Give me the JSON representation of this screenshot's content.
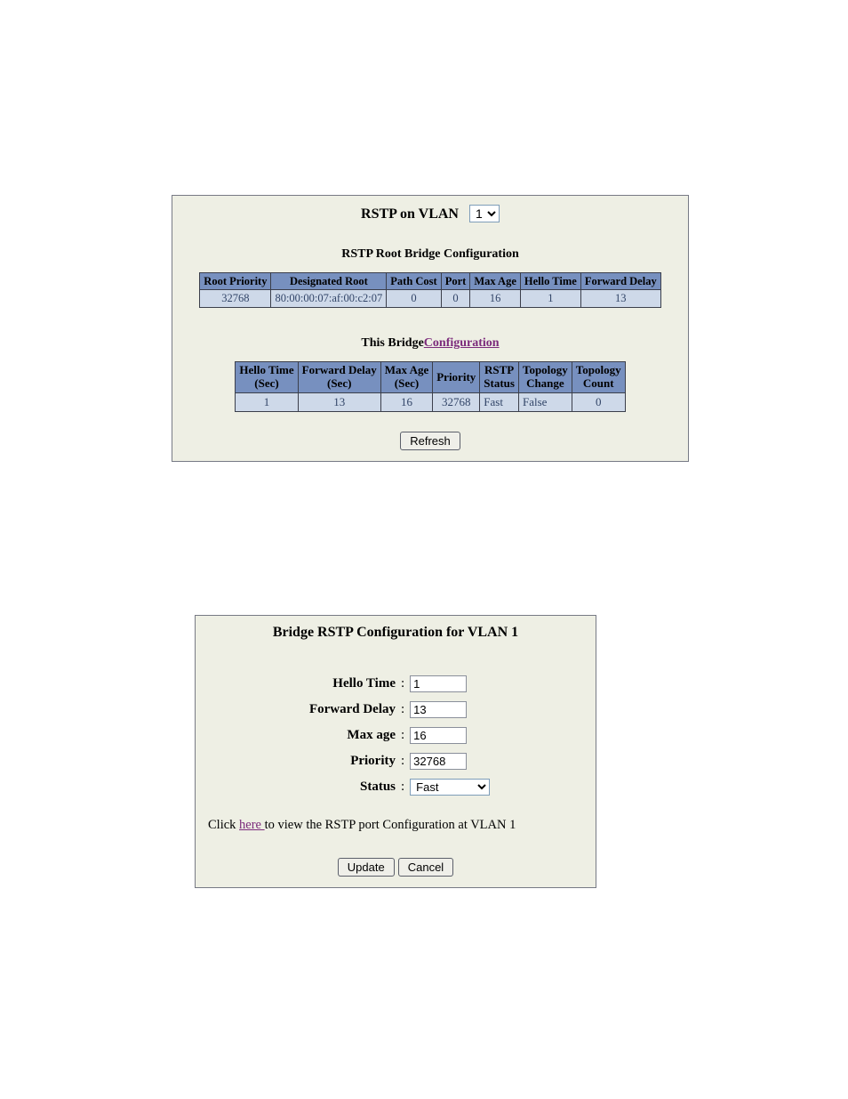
{
  "title": {
    "label": "RSTP on VLAN",
    "selected": "1"
  },
  "rootConfig": {
    "title": "RSTP Root Bridge Configuration",
    "headers": [
      "Root Priority",
      "Designated Root",
      "Path Cost",
      "Port",
      "Max Age",
      "Hello Time",
      "Forward Delay"
    ],
    "row": [
      "32768",
      "80:00:00:07:af:00:c2:07",
      "0",
      "0",
      "16",
      "1",
      "13"
    ]
  },
  "bridge": {
    "title_prefix": "This Bridge",
    "config_link": "Configuration",
    "headers": [
      "Hello Time (Sec)",
      "Forward Delay (Sec)",
      "Max Age (Sec)",
      "Priority",
      "RSTP Status",
      "Topology Change",
      "Topology Count"
    ],
    "row": [
      "1",
      "13",
      "16",
      "32768",
      "Fast",
      "False",
      "0"
    ]
  },
  "refresh_label": "Refresh",
  "panel2": {
    "title": "Bridge RSTP Configuration for VLAN 1",
    "fields": {
      "hello": {
        "label": "Hello Time",
        "value": "1"
      },
      "fwd": {
        "label": "Forward Delay",
        "value": "13"
      },
      "maxage": {
        "label": "Max age",
        "value": "16"
      },
      "prio": {
        "label": "Priority",
        "value": "32768"
      },
      "status": {
        "label": "Status",
        "value": "Fast"
      }
    },
    "hint_pre": "Click ",
    "hint_link": " here ",
    "hint_post": " to view the RSTP port Configuration at VLAN 1",
    "update": "Update",
    "cancel": "Cancel"
  }
}
